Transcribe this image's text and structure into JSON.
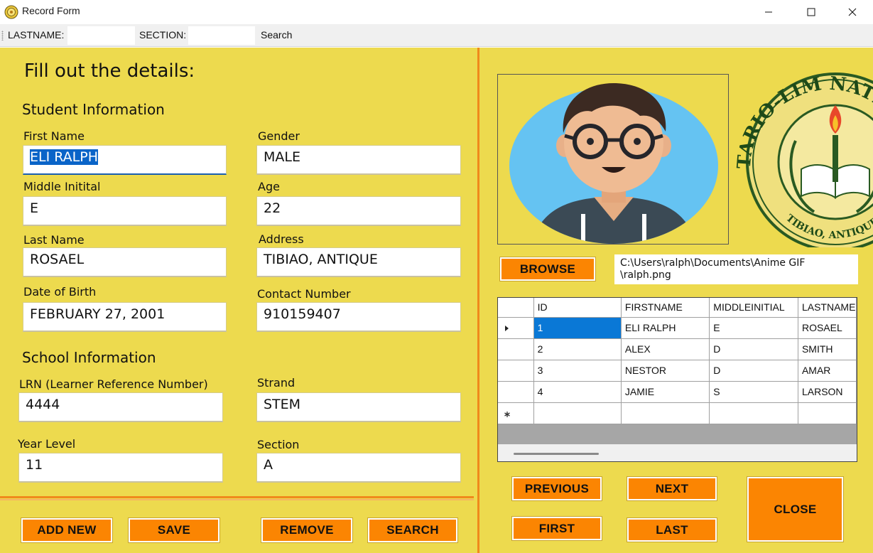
{
  "window": {
    "title": "Record Form",
    "controls": [
      "minimize-icon",
      "maximize-icon",
      "close-icon"
    ]
  },
  "toolbar": {
    "lastname_label": "LASTNAME:",
    "lastname_value": "",
    "section_label": "SECTION:",
    "section_value": "",
    "search_label": "Search"
  },
  "form": {
    "heading": "Fill out the details:",
    "student_section": "Student Information",
    "school_section": "School Information",
    "first_name": {
      "label": "First Name",
      "value": "ELI RALPH"
    },
    "gender": {
      "label": "Gender",
      "value": "MALE"
    },
    "middle_initial": {
      "label": "Middle Initital",
      "value": "E"
    },
    "age": {
      "label": "Age",
      "value": "22"
    },
    "last_name": {
      "label": "Last Name",
      "value": "ROSAEL"
    },
    "address": {
      "label": "Address",
      "value": "TIBIAO, ANTIQUE"
    },
    "dob": {
      "label": "Date of Birth",
      "value": "FEBRUARY 27, 2001"
    },
    "contact": {
      "label": "Contact Number",
      "value": "910159407"
    },
    "lrn": {
      "label": "LRN (Learner Reference Number)",
      "value": "4444"
    },
    "strand": {
      "label": "Strand",
      "value": "STEM"
    },
    "year_level": {
      "label": "Year Level",
      "value": "11"
    },
    "section": {
      "label": "Section",
      "value": "A"
    }
  },
  "actions": {
    "add_new": "ADD NEW",
    "save": "SAVE",
    "remove": "REMOVE",
    "search": "SEARCH"
  },
  "photo": {
    "browse": "BROWSE",
    "path_line1": "C:\\Users\\ralph\\Documents\\Anime GIF",
    "path_line2": "\\ralph.png",
    "seal_text_top": "TARIO-LIM NATIONAL MEMO",
    "seal_text_bottom": "TIBIAO, ANTIQUE"
  },
  "grid": {
    "columns": [
      "ID",
      "FIRSTNAME",
      "MIDDLEINITIAL",
      "LASTNAME"
    ],
    "rows": [
      {
        "id": "1",
        "firstname": "ELI RALPH",
        "middleinitial": "E",
        "lastname": "ROSAEL"
      },
      {
        "id": "2",
        "firstname": "ALEX",
        "middleinitial": "D",
        "lastname": "SMITH"
      },
      {
        "id": "3",
        "firstname": "NESTOR",
        "middleinitial": "D",
        "lastname": "AMAR"
      },
      {
        "id": "4",
        "firstname": "JAMIE",
        "middleinitial": "S",
        "lastname": "LARSON"
      }
    ],
    "selected_row": 0
  },
  "nav": {
    "previous": "PREVIOUS",
    "next": "NEXT",
    "first": "FIRST",
    "last": "LAST",
    "close": "CLOSE"
  },
  "colors": {
    "panel": "#edda4e",
    "button": "#fb8502",
    "selection": "#0a64c8",
    "divider": "#f08a1c"
  }
}
